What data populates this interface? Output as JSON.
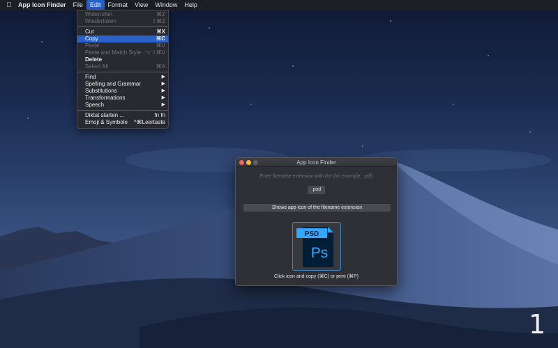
{
  "menubar": {
    "app_name": "App Icon Finder",
    "items": [
      "File",
      "Edit",
      "Format",
      "View",
      "Window",
      "Help"
    ],
    "active": "Edit"
  },
  "edit_menu": {
    "undo": {
      "label": "Widerrufen",
      "shortcut": "⌘Z"
    },
    "redo": {
      "label": "Wiederholen",
      "shortcut": "⇧⌘Z"
    },
    "cut": {
      "label": "Cut",
      "shortcut": "⌘X"
    },
    "copy": {
      "label": "Copy",
      "shortcut": "⌘C"
    },
    "paste": {
      "label": "Paste",
      "shortcut": "⌘V"
    },
    "paste_match": {
      "label": "Paste and Match Style",
      "shortcut": "⌥⇧⌘V"
    },
    "delete": {
      "label": "Delete"
    },
    "select_all": {
      "label": "Select All",
      "shortcut": "⌘A"
    },
    "find": {
      "label": "Find"
    },
    "spelling": {
      "label": "Spelling and Grammar"
    },
    "substitutions": {
      "label": "Substitutions"
    },
    "transformations": {
      "label": "Transformations"
    },
    "speech": {
      "label": "Speech"
    },
    "dictation": {
      "label": "Diktat starten ...",
      "shortcut": "fn fn"
    },
    "emoji": {
      "label": "Emoji & Symbole",
      "shortcut": "^⌘Leertaste"
    }
  },
  "window": {
    "title": "App Icon Finder",
    "hint": "Enter filename extension with dot (for example: .pdf)",
    "extension_value": ".psd",
    "show_button": "Shows app icon of the filename extension",
    "icon_label": "PSD",
    "icon_letters": "Ps",
    "caption": "Click icon and copy (⌘C) or print (⌘P)"
  },
  "page_number": "1",
  "colors": {
    "accent": "#2a62c9",
    "psd_blue": "#31a8ff",
    "psd_dark": "#001e36"
  }
}
